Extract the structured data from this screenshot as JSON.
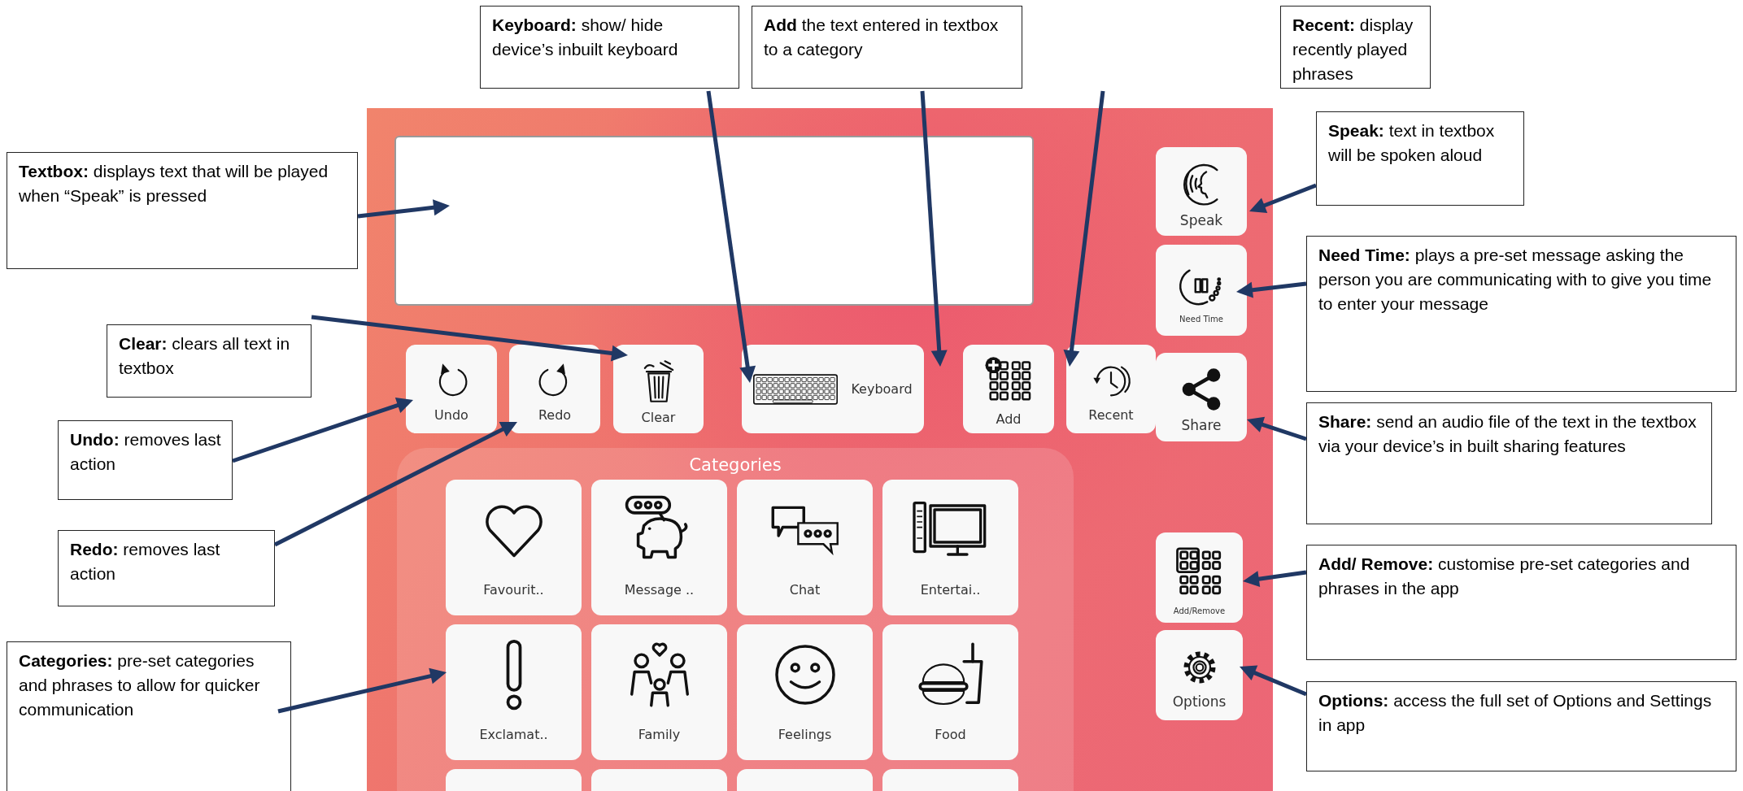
{
  "app": {
    "toolbar": [
      {
        "label": "Undo"
      },
      {
        "label": "Redo"
      },
      {
        "label": "Clear"
      },
      {
        "label": "Keyboard"
      },
      {
        "label": "Add"
      },
      {
        "label": "Recent"
      }
    ],
    "side_buttons": [
      {
        "label": "Speak"
      },
      {
        "label": "Need Time"
      },
      {
        "label": "Share"
      },
      {
        "label": "Add/Remove"
      },
      {
        "label": "Options"
      }
    ],
    "categories": {
      "title": "Categories",
      "tiles": [
        {
          "label": "Favourit.."
        },
        {
          "label": "Message .."
        },
        {
          "label": "Chat"
        },
        {
          "label": "Entertai.."
        },
        {
          "label": "Exclamat.."
        },
        {
          "label": "Family"
        },
        {
          "label": "Feelings"
        },
        {
          "label": "Food"
        }
      ]
    }
  },
  "callouts": [
    {
      "text": "**Keyboard:** show/ hide device’s inbuilt keyboard"
    },
    {
      "text": "**Add** the text entered in textbox to a category"
    },
    {
      "text": "**Recent:** display recently played phrases"
    },
    {
      "text": "**Textbox:** displays text that will be played when “Speak” is pressed"
    },
    {
      "text": "**Speak:** text in textbox will be spoken aloud"
    },
    {
      "text": "**Need Time:** plays a pre-set message asking the person you are communicating with to give you time to enter your message"
    },
    {
      "text": "**Clear:**  clears all text in textbox"
    },
    {
      "text": "**Undo:** removes last action"
    },
    {
      "text": "**Redo:** removes last action"
    },
    {
      "text": "**Share:** send an audio file of the text in the textbox via your device’s in built sharing features"
    },
    {
      "text": "**Add/ Remove:** customise pre-set categories and phrases in the app"
    },
    {
      "text": "**Categories:** pre-set categories and phrases to allow for quicker communication"
    },
    {
      "text": "**Options:** access the full set of Options and Settings in app"
    }
  ]
}
